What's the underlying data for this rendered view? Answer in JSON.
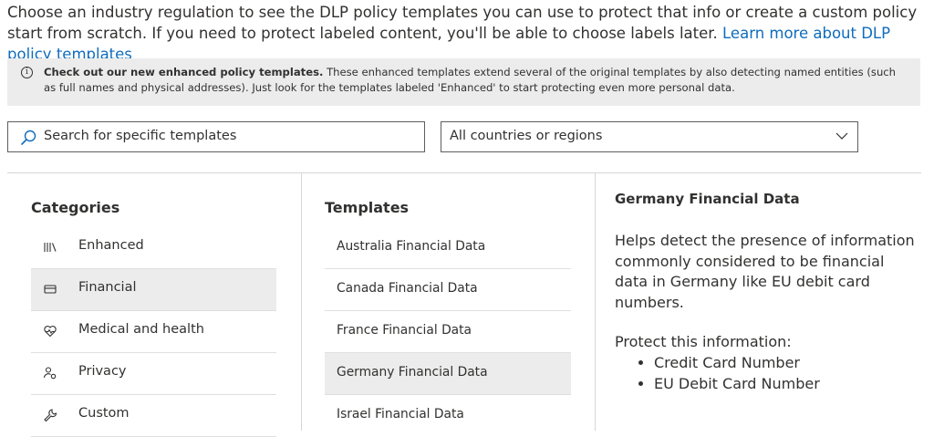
{
  "intro": {
    "text": "Choose an industry regulation to see the DLP policy templates you can use to protect that info or create a custom policy start from scratch. If you need to protect labeled content, you'll be able to choose labels later.",
    "link": "Learn more about DLP policy templates"
  },
  "banner": {
    "bold": "Check out our new enhanced policy templates.",
    "text": "These enhanced templates extend several of the original templates by also detecting named entities (such as full names and physical addresses). Just look for the templates labeled 'Enhanced' to start protecting even more personal data."
  },
  "search": {
    "placeholder": "Search for specific templates"
  },
  "region": {
    "selected": "All countries or regions"
  },
  "categories": {
    "title": "Categories",
    "items": [
      {
        "label": "Enhanced",
        "icon": "library-icon",
        "selected": false
      },
      {
        "label": "Financial",
        "icon": "card-icon",
        "selected": true
      },
      {
        "label": "Medical and health",
        "icon": "heart-pulse-icon",
        "selected": false
      },
      {
        "label": "Privacy",
        "icon": "person-key-icon",
        "selected": false
      },
      {
        "label": "Custom",
        "icon": "wrench-icon",
        "selected": false
      }
    ]
  },
  "templates": {
    "title": "Templates",
    "items": [
      {
        "label": "Australia Financial Data",
        "selected": false
      },
      {
        "label": "Canada Financial Data",
        "selected": false
      },
      {
        "label": "France Financial Data",
        "selected": false
      },
      {
        "label": "Germany Financial Data",
        "selected": true
      },
      {
        "label": "Israel Financial Data",
        "selected": false
      }
    ]
  },
  "detail": {
    "title": "Germany Financial Data",
    "description": "Helps detect the presence of information commonly considered to be financial data in Germany like EU debit card numbers.",
    "protect_title": "Protect this information:",
    "protect_items": [
      "Credit Card Number",
      "EU Debit Card Number"
    ]
  }
}
